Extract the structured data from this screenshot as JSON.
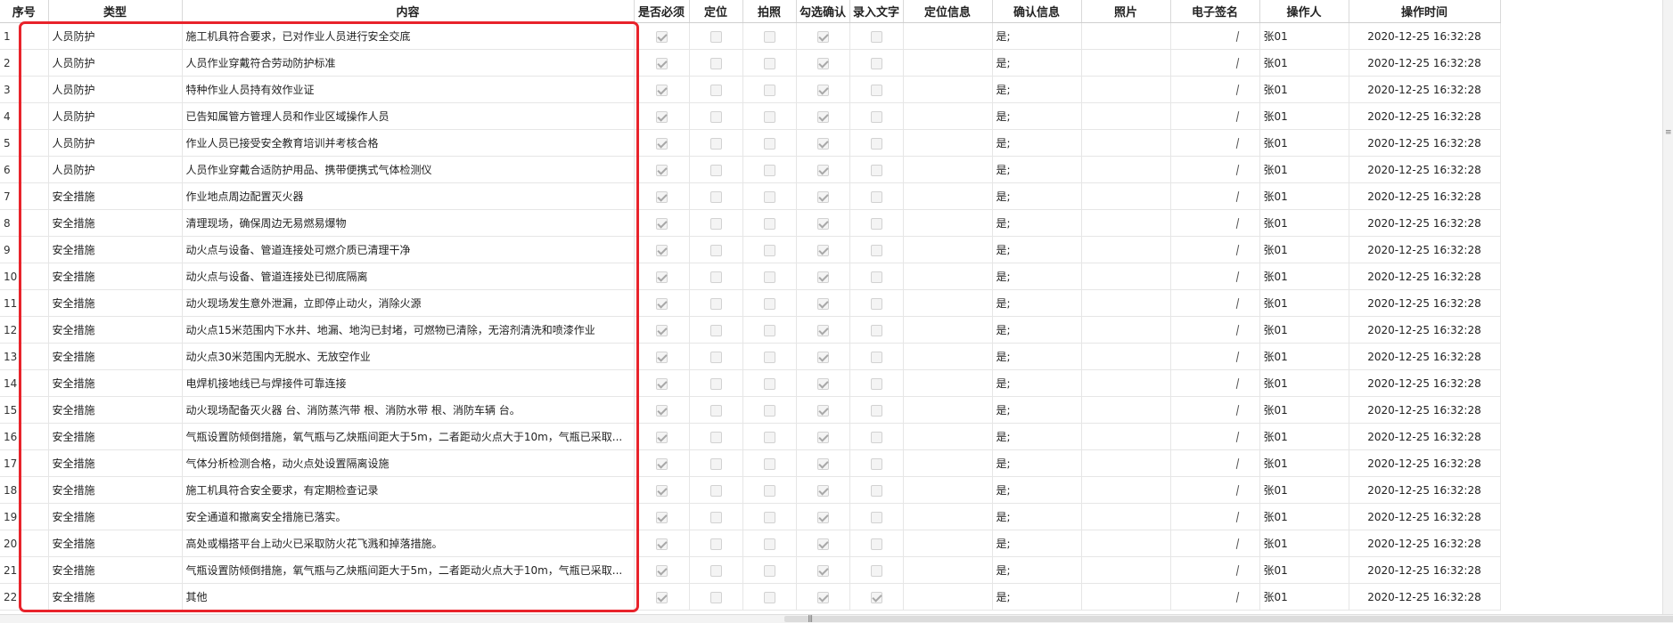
{
  "columns": [
    {
      "key": "seq",
      "label": "序号"
    },
    {
      "key": "type",
      "label": "类型"
    },
    {
      "key": "content",
      "label": "内容"
    },
    {
      "key": "required",
      "label": "是否必须"
    },
    {
      "key": "locate",
      "label": "定位"
    },
    {
      "key": "photo_flag",
      "label": "拍照"
    },
    {
      "key": "check_confirm",
      "label": "勾选确认"
    },
    {
      "key": "enter_text",
      "label": "录入文字"
    },
    {
      "key": "location_info",
      "label": "定位信息"
    },
    {
      "key": "confirm_info",
      "label": "确认信息"
    },
    {
      "key": "photo",
      "label": "照片"
    },
    {
      "key": "signature",
      "label": "电子签名"
    },
    {
      "key": "operator",
      "label": "操作人"
    },
    {
      "key": "time",
      "label": "操作时间"
    }
  ],
  "rows": [
    {
      "seq": "1",
      "type": "人员防护",
      "content": "施工机具符合要求，已对作业人员进行安全交底",
      "required": true,
      "locate": false,
      "photo_flag": false,
      "check_confirm": true,
      "enter_text": false,
      "confirm_info": "是;",
      "operator": "张01",
      "time": "2020-12-25 16:32:28"
    },
    {
      "seq": "2",
      "type": "人员防护",
      "content": "人员作业穿戴符合劳动防护标准",
      "required": true,
      "locate": false,
      "photo_flag": false,
      "check_confirm": true,
      "enter_text": false,
      "confirm_info": "是;",
      "operator": "张01",
      "time": "2020-12-25 16:32:28"
    },
    {
      "seq": "3",
      "type": "人员防护",
      "content": "特种作业人员持有效作业证",
      "required": true,
      "locate": false,
      "photo_flag": false,
      "check_confirm": true,
      "enter_text": false,
      "confirm_info": "是;",
      "operator": "张01",
      "time": "2020-12-25 16:32:28"
    },
    {
      "seq": "4",
      "type": "人员防护",
      "content": "已告知属管方管理人员和作业区域操作人员",
      "required": true,
      "locate": false,
      "photo_flag": false,
      "check_confirm": true,
      "enter_text": false,
      "confirm_info": "是;",
      "operator": "张01",
      "time": "2020-12-25 16:32:28"
    },
    {
      "seq": "5",
      "type": "人员防护",
      "content": "作业人员已接受安全教育培训并考核合格",
      "required": true,
      "locate": false,
      "photo_flag": false,
      "check_confirm": true,
      "enter_text": false,
      "confirm_info": "是;",
      "operator": "张01",
      "time": "2020-12-25 16:32:28"
    },
    {
      "seq": "6",
      "type": "人员防护",
      "content": "人员作业穿戴合适防护用品、携带便携式气体检测仪",
      "required": true,
      "locate": false,
      "photo_flag": false,
      "check_confirm": true,
      "enter_text": false,
      "confirm_info": "是;",
      "operator": "张01",
      "time": "2020-12-25 16:32:28"
    },
    {
      "seq": "7",
      "type": "安全措施",
      "content": "作业地点周边配置灭火器",
      "required": true,
      "locate": false,
      "photo_flag": false,
      "check_confirm": true,
      "enter_text": false,
      "confirm_info": "是;",
      "operator": "张01",
      "time": "2020-12-25 16:32:28"
    },
    {
      "seq": "8",
      "type": "安全措施",
      "content": "清理现场，确保周边无易燃易爆物",
      "required": true,
      "locate": false,
      "photo_flag": false,
      "check_confirm": true,
      "enter_text": false,
      "confirm_info": "是;",
      "operator": "张01",
      "time": "2020-12-25 16:32:28"
    },
    {
      "seq": "9",
      "type": "安全措施",
      "content": "动火点与设备、管道连接处可燃介质已清理干净",
      "required": true,
      "locate": false,
      "photo_flag": false,
      "check_confirm": true,
      "enter_text": false,
      "confirm_info": "是;",
      "operator": "张01",
      "time": "2020-12-25 16:32:28"
    },
    {
      "seq": "10",
      "type": "安全措施",
      "content": "动火点与设备、管道连接处已彻底隔离",
      "required": true,
      "locate": false,
      "photo_flag": false,
      "check_confirm": true,
      "enter_text": false,
      "confirm_info": "是;",
      "operator": "张01",
      "time": "2020-12-25 16:32:28"
    },
    {
      "seq": "11",
      "type": "安全措施",
      "content": "动火现场发生意外泄漏，立即停止动火，消除火源",
      "required": true,
      "locate": false,
      "photo_flag": false,
      "check_confirm": true,
      "enter_text": false,
      "confirm_info": "是;",
      "operator": "张01",
      "time": "2020-12-25 16:32:28"
    },
    {
      "seq": "12",
      "type": "安全措施",
      "content": "动火点15米范围内下水井、地漏、地沟已封堵，可燃物已清除，无溶剂清洗和喷漆作业",
      "required": true,
      "locate": false,
      "photo_flag": false,
      "check_confirm": true,
      "enter_text": false,
      "confirm_info": "是;",
      "operator": "张01",
      "time": "2020-12-25 16:32:28"
    },
    {
      "seq": "13",
      "type": "安全措施",
      "content": "动火点30米范围内无脱水、无放空作业",
      "required": true,
      "locate": false,
      "photo_flag": false,
      "check_confirm": true,
      "enter_text": false,
      "confirm_info": "是;",
      "operator": "张01",
      "time": "2020-12-25 16:32:28"
    },
    {
      "seq": "14",
      "type": "安全措施",
      "content": "电焊机接地线已与焊接件可靠连接",
      "required": true,
      "locate": false,
      "photo_flag": false,
      "check_confirm": true,
      "enter_text": false,
      "confirm_info": "是;",
      "operator": "张01",
      "time": "2020-12-25 16:32:28"
    },
    {
      "seq": "15",
      "type": "安全措施",
      "content": "动火现场配备灭火器 台、消防蒸汽带 根、消防水带 根、消防车辆 台。",
      "required": true,
      "locate": false,
      "photo_flag": false,
      "check_confirm": true,
      "enter_text": false,
      "confirm_info": "是;",
      "operator": "张01",
      "time": "2020-12-25 16:32:28"
    },
    {
      "seq": "16",
      "type": "安全措施",
      "content": "气瓶设置防倾倒措施，氧气瓶与乙炔瓶间距大于5m，二者距动火点大于10m，气瓶已采取...",
      "required": true,
      "locate": false,
      "photo_flag": false,
      "check_confirm": true,
      "enter_text": false,
      "confirm_info": "是;",
      "operator": "张01",
      "time": "2020-12-25 16:32:28"
    },
    {
      "seq": "17",
      "type": "安全措施",
      "content": "气体分析检测合格，动火点处设置隔离设施",
      "required": true,
      "locate": false,
      "photo_flag": false,
      "check_confirm": true,
      "enter_text": false,
      "confirm_info": "是;",
      "operator": "张01",
      "time": "2020-12-25 16:32:28"
    },
    {
      "seq": "18",
      "type": "安全措施",
      "content": "施工机具符合安全要求，有定期检查记录",
      "required": true,
      "locate": false,
      "photo_flag": false,
      "check_confirm": true,
      "enter_text": false,
      "confirm_info": "是;",
      "operator": "张01",
      "time": "2020-12-25 16:32:28"
    },
    {
      "seq": "19",
      "type": "安全措施",
      "content": "安全通道和撤离安全措施已落实。",
      "required": true,
      "locate": false,
      "photo_flag": false,
      "check_confirm": true,
      "enter_text": false,
      "confirm_info": "是;",
      "operator": "张01",
      "time": "2020-12-25 16:32:28"
    },
    {
      "seq": "20",
      "type": "安全措施",
      "content": "高处或榻搭平台上动火已采取防火花飞溅和掉落措施。",
      "required": true,
      "locate": false,
      "photo_flag": false,
      "check_confirm": true,
      "enter_text": false,
      "confirm_info": "是;",
      "operator": "张01",
      "time": "2020-12-25 16:32:28"
    },
    {
      "seq": "21",
      "type": "安全措施",
      "content": "气瓶设置防倾倒措施，氧气瓶与乙炔瓶间距大于5m，二者距动火点大于10m，气瓶已采取...",
      "required": true,
      "locate": false,
      "photo_flag": false,
      "check_confirm": true,
      "enter_text": false,
      "confirm_info": "是;",
      "operator": "张01",
      "time": "2020-12-25 16:32:28"
    },
    {
      "seq": "22",
      "type": "安全措施",
      "content": "其他",
      "required": true,
      "locate": false,
      "photo_flag": false,
      "check_confirm": true,
      "enter_text": true,
      "confirm_info": "是;",
      "operator": "张01",
      "time": "2020-12-25 16:32:28"
    }
  ],
  "colors": {
    "highlight": "#e8232b",
    "grid_line": "#e6e6e6",
    "checkbox_disabled": "#f4f4f4"
  }
}
